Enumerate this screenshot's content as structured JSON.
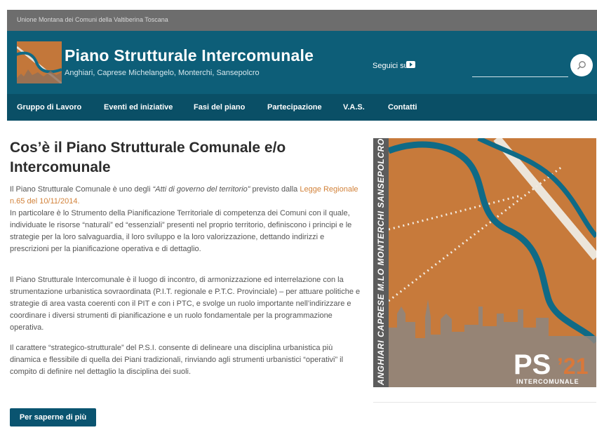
{
  "topbar": {
    "text": "Unione Montana dei Comuni della Valtiberina Toscana"
  },
  "header": {
    "title": "Piano Strutturale Intercomunale",
    "subtitle": "Anghiari, Caprese Michelangelo, Monterchi, Sansepolcro",
    "follow_label": "Seguici su",
    "follow_icon": "youtube-icon",
    "search_icon": "search-icon"
  },
  "nav": {
    "items": [
      {
        "label": "Gruppo di Lavoro"
      },
      {
        "label": "Eventi ed iniziative"
      },
      {
        "label": "Fasi del piano"
      },
      {
        "label": "Partecipazione"
      },
      {
        "label": "V.A.S."
      },
      {
        "label": "Contatti"
      }
    ]
  },
  "main": {
    "title": "Cos’è il Piano Strutturale Comunale e/o Intercomunale",
    "p1_before": "Il Piano Strutturale Comunale è uno degli ",
    "p1_em": "“Atti di governo del territorio”",
    "p1_middle": " previsto dalla ",
    "p1_link": "Legge Regionale n.65 del 10/11/2014.",
    "p1_rest": "In particolare è lo Strumento della Pianificazione Territoriale di competenza dei Comuni con il quale, individuate le risorse “naturali” ed “essenziali” presenti nel proprio territorio, definiscono i principi e le strategie per la loro salvaguardia, il loro sviluppo e la loro valorizzazione, dettando indirizzi e prescrizioni per la pianificazione operativa e di dettaglio.",
    "p2": "Il Piano Strutturale Intercomunale è il luogo di incontro, di armonizzazione ed interrelazione con la strumentazione urbanistica sovraordinata (P.I.T. regionale e P.T.C. Provinciale) – per attuare politiche e strategie di area vasta coerenti con il PIT e con i PTC, e svolge un ruolo importante nell’indirizzare e coordinare i diversi strumenti di pianificazione e un ruolo fondamentale per la programmazione operativa.",
    "p3": "Il carattere “strategico-strutturale” del P.S.I. consente di delineare una disciplina urbanistica più dinamica e flessibile di quella dei Piani tradizionali, rinviando agli strumenti urbanistici “operativi” il compito di definire nel dettaglio la disciplina dei suoli.",
    "more_button": "Per saperne di più"
  },
  "poster": {
    "vertical_text": "ANGHIARI CAPRESE M.LO MONTERCHI SANSEPOLCRO",
    "ps": "PS",
    "year": "’21",
    "label": "INTERCOMUNALE"
  },
  "colors": {
    "header_bg": "#0d5e78",
    "nav_bg": "#0a4f66",
    "poster_orange": "#c77a3b",
    "river_blue": "#0f6a86",
    "accent_link": "#d2823a"
  }
}
